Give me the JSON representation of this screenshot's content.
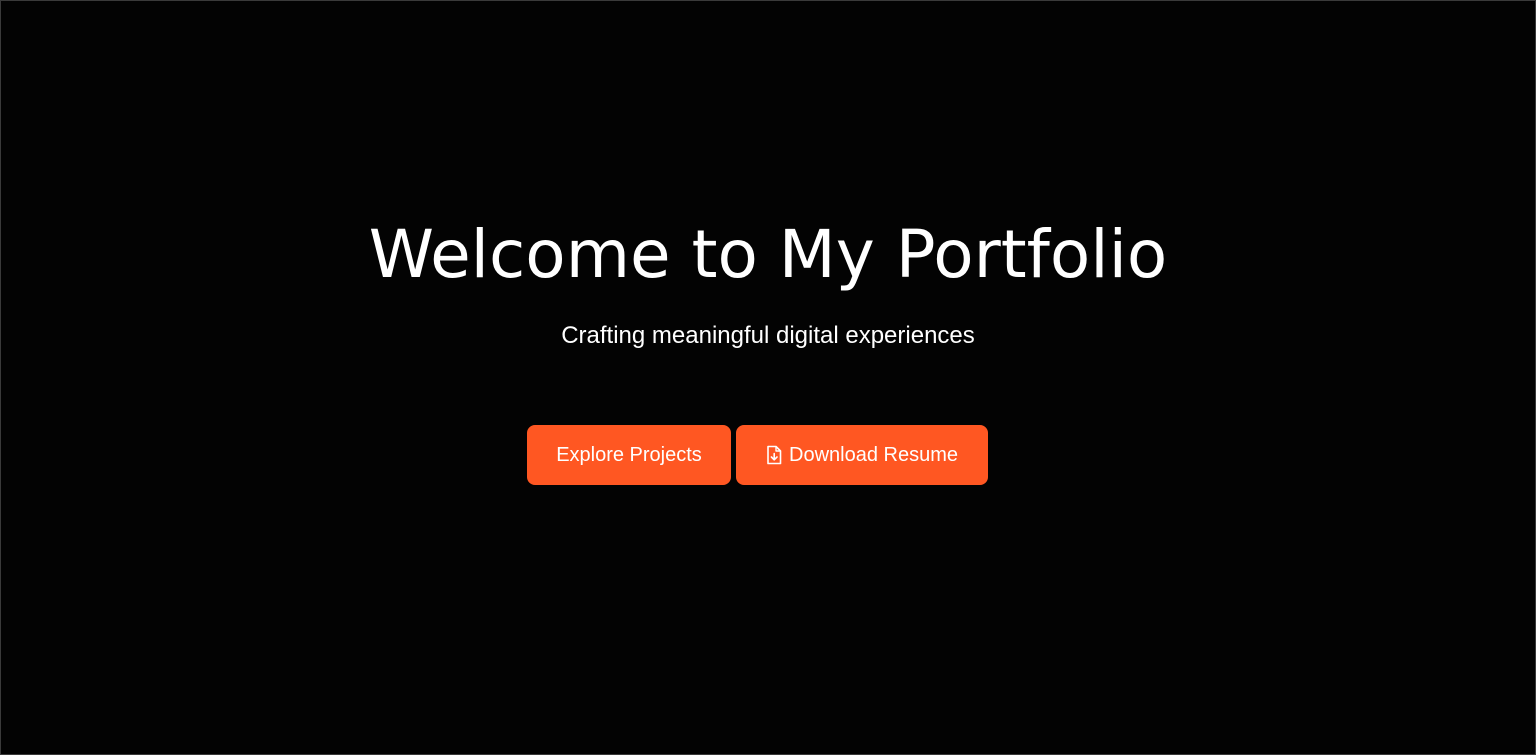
{
  "hero": {
    "title": "Welcome to My Portfolio",
    "subtitle": "Crafting meaningful digital experiences"
  },
  "actions": {
    "explore_label": "Explore Projects",
    "resume_label": "Download Resume",
    "resume_icon": "file-download-icon"
  },
  "colors": {
    "background": "#030303",
    "accent": "#ff5722",
    "text": "#ffffff"
  }
}
